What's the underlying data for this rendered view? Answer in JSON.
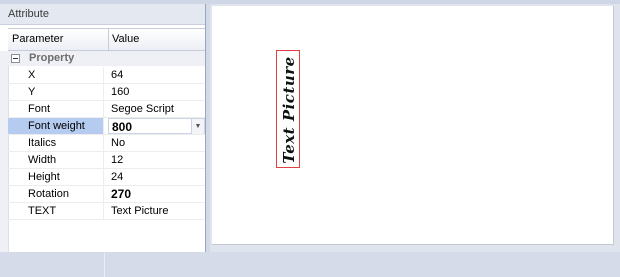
{
  "panel": {
    "title": "Attribute"
  },
  "grid": {
    "header": {
      "parameter": "Parameter",
      "value": "Value"
    },
    "category": "Property",
    "properties": [
      {
        "name": "X",
        "value": "64"
      },
      {
        "name": "Y",
        "value": "160"
      },
      {
        "name": "Font",
        "value": "Segoe Script"
      },
      {
        "name": "Font weight",
        "value": "800"
      },
      {
        "name": "Italics",
        "value": "No"
      },
      {
        "name": "Width",
        "value": "12"
      },
      {
        "name": "Height",
        "value": "24"
      },
      {
        "name": "Rotation",
        "value": "270"
      },
      {
        "name": "TEXT",
        "value": "Text Picture"
      }
    ]
  },
  "canvas": {
    "text_item": "Text Picture"
  },
  "colors": {
    "selection": "#b5cbef",
    "frame": "#e04040"
  },
  "icons": {
    "expander": "collapse-minus-icon",
    "dropdown": "chevron-down-icon"
  }
}
